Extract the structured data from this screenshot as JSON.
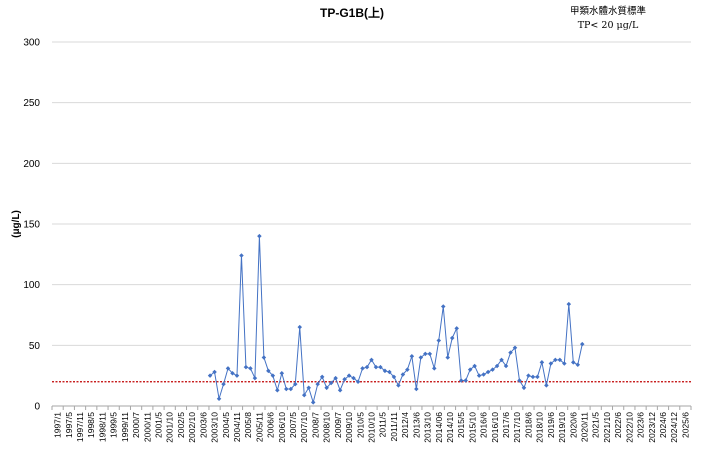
{
  "chart_data": {
    "type": "line",
    "title": "TP-G1B(上)",
    "standard_label_line1": "甲類水體水質標準",
    "standard_label_line2": "TP< 20 μg/L",
    "ylabel": "(μg/L)",
    "xlabel": "",
    "ylim": [
      0,
      300
    ],
    "yticks": [
      0,
      50,
      100,
      150,
      200,
      250,
      300
    ],
    "grid": true,
    "legend": "none",
    "colors": {
      "series": "#4472C4",
      "standard": "#C00000",
      "grid": "#D9D9D9"
    },
    "x_tick_labels": [
      "1997/1",
      "1997/5",
      "1997/11",
      "1998/5",
      "1998/11",
      "1999/5",
      "1999/11",
      "2000/7",
      "2000/11",
      "2001/5",
      "2001/10",
      "2002/5",
      "2002/10",
      "2003/6",
      "2003/10",
      "2004/5",
      "2004/11",
      "2005/8",
      "2005/11",
      "2006/6",
      "2006/10",
      "2007/5",
      "2007/10",
      "2008/7",
      "2008/10",
      "2009/7",
      "2009/10",
      "2010/5",
      "2010/10",
      "2011/5",
      "2011/11",
      "2012/4",
      "2013/6",
      "2013/10",
      "2014/06",
      "2014/10",
      "2015/5",
      "2015/10",
      "2016/6",
      "2016/10",
      "2017/6",
      "2017/10",
      "2018/6",
      "2018/10",
      "2019/6",
      "2019/10",
      "2020/6",
      "2020/11",
      "2021/5",
      "2021/10",
      "2022/6",
      "2022/10",
      "2023/6",
      "2023/12",
      "2024/6",
      "2024/12",
      "2025/6"
    ],
    "standard_value": 20,
    "series": [
      {
        "values": [
          {
            "x": 13.6,
            "y": 25
          },
          {
            "x": 14.0,
            "y": 28
          },
          {
            "x": 14.4,
            "y": 6
          },
          {
            "x": 14.8,
            "y": 18
          },
          {
            "x": 15.2,
            "y": 31
          },
          {
            "x": 15.6,
            "y": 27
          },
          {
            "x": 16.0,
            "y": 25
          },
          {
            "x": 16.4,
            "y": 124
          },
          {
            "x": 16.8,
            "y": 32
          },
          {
            "x": 17.2,
            "y": 31
          },
          {
            "x": 17.6,
            "y": 23
          },
          {
            "x": 18.0,
            "y": 140
          },
          {
            "x": 18.4,
            "y": 40
          },
          {
            "x": 18.8,
            "y": 29
          },
          {
            "x": 19.2,
            "y": 25
          },
          {
            "x": 19.6,
            "y": 13
          },
          {
            "x": 20.0,
            "y": 27
          },
          {
            "x": 20.4,
            "y": 14
          },
          {
            "x": 20.8,
            "y": 14
          },
          {
            "x": 21.2,
            "y": 18
          },
          {
            "x": 21.6,
            "y": 65
          },
          {
            "x": 22.0,
            "y": 9
          },
          {
            "x": 22.4,
            "y": 15
          },
          {
            "x": 22.8,
            "y": 3
          },
          {
            "x": 23.2,
            "y": 18
          },
          {
            "x": 23.6,
            "y": 24
          },
          {
            "x": 24.0,
            "y": 15
          },
          {
            "x": 24.4,
            "y": 19
          },
          {
            "x": 24.8,
            "y": 23
          },
          {
            "x": 25.2,
            "y": 13
          },
          {
            "x": 25.6,
            "y": 22
          },
          {
            "x": 26.0,
            "y": 25
          },
          {
            "x": 26.4,
            "y": 23
          },
          {
            "x": 26.8,
            "y": 20
          },
          {
            "x": 27.2,
            "y": 31
          },
          {
            "x": 27.6,
            "y": 32
          },
          {
            "x": 28.0,
            "y": 38
          },
          {
            "x": 28.4,
            "y": 32
          },
          {
            "x": 28.8,
            "y": 32
          },
          {
            "x": 29.2,
            "y": 29
          },
          {
            "x": 29.6,
            "y": 28
          },
          {
            "x": 30.0,
            "y": 24
          },
          {
            "x": 30.4,
            "y": 17
          },
          {
            "x": 30.8,
            "y": 26
          },
          {
            "x": 31.2,
            "y": 30
          },
          {
            "x": 31.6,
            "y": 41
          },
          {
            "x": 32.0,
            "y": 14
          },
          {
            "x": 32.4,
            "y": 40
          },
          {
            "x": 32.8,
            "y": 43
          },
          {
            "x": 33.2,
            "y": 43
          },
          {
            "x": 33.6,
            "y": 31
          },
          {
            "x": 34.0,
            "y": 54
          },
          {
            "x": 34.4,
            "y": 82
          },
          {
            "x": 34.8,
            "y": 40
          },
          {
            "x": 35.2,
            "y": 56
          },
          {
            "x": 35.6,
            "y": 64
          },
          {
            "x": 36.0,
            "y": 21
          },
          {
            "x": 36.4,
            "y": 21
          },
          {
            "x": 36.8,
            "y": 30
          },
          {
            "x": 37.2,
            "y": 33
          },
          {
            "x": 37.6,
            "y": 25
          },
          {
            "x": 38.0,
            "y": 26
          },
          {
            "x": 38.4,
            "y": 28
          },
          {
            "x": 38.8,
            "y": 30
          },
          {
            "x": 39.2,
            "y": 33
          },
          {
            "x": 39.6,
            "y": 38
          },
          {
            "x": 40.0,
            "y": 33
          },
          {
            "x": 40.4,
            "y": 44
          },
          {
            "x": 40.8,
            "y": 48
          },
          {
            "x": 41.2,
            "y": 21
          },
          {
            "x": 41.6,
            "y": 15
          },
          {
            "x": 42.0,
            "y": 25
          },
          {
            "x": 42.4,
            "y": 24
          },
          {
            "x": 42.8,
            "y": 24
          },
          {
            "x": 43.2,
            "y": 36
          },
          {
            "x": 43.6,
            "y": 17
          },
          {
            "x": 44.0,
            "y": 35
          },
          {
            "x": 44.4,
            "y": 38
          },
          {
            "x": 44.8,
            "y": 38
          },
          {
            "x": 45.2,
            "y": 35
          },
          {
            "x": 45.6,
            "y": 84
          },
          {
            "x": 46.0,
            "y": 36
          },
          {
            "x": 46.4,
            "y": 34
          },
          {
            "x": 46.8,
            "y": 51
          }
        ]
      }
    ]
  }
}
